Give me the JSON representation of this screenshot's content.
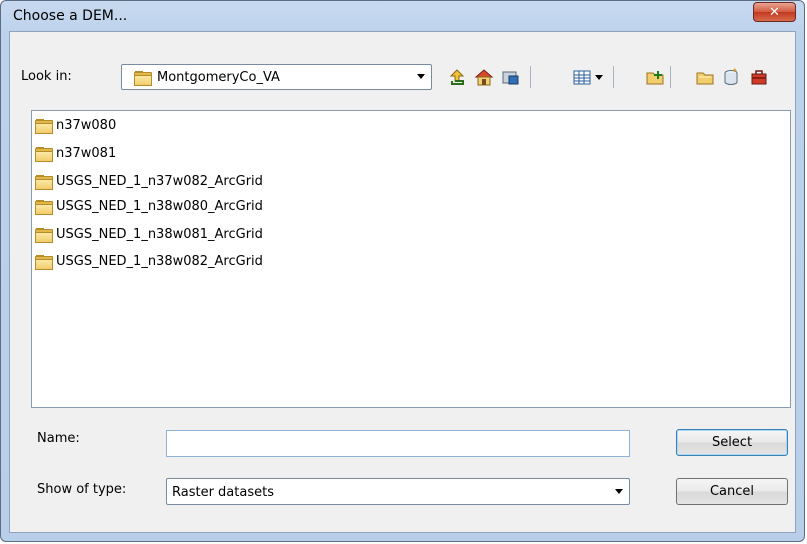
{
  "window": {
    "title": "Choose a DEM...",
    "close_glyph": "✕"
  },
  "lookin": {
    "label": "Look in:",
    "value": "MontgomeryCo_VA",
    "icons": [
      "up-one-level-icon",
      "home-icon",
      "network-folder-icon",
      "view-menu-icon",
      "connect-folder-icon",
      "new-folder-icon",
      "new-geodatabase-icon",
      "toolbox-icon"
    ]
  },
  "files": [
    {
      "name": "n37w080",
      "icon": "folder-icon"
    },
    {
      "name": "n37w081",
      "icon": "folder-icon"
    },
    {
      "name": "USGS_NED_1_n37w082_ArcGrid",
      "icon": "folder-icon"
    },
    {
      "name": "USGS_NED_1_n38w080_ArcGrid",
      "icon": "folder-icon"
    },
    {
      "name": "USGS_NED_1_n38w081_ArcGrid",
      "icon": "folder-icon"
    },
    {
      "name": "USGS_NED_1_n38w082_ArcGrid",
      "icon": "folder-icon"
    }
  ],
  "form": {
    "name_label": "Name:",
    "name_value": "",
    "type_label": "Show of type:",
    "type_value": "Raster datasets"
  },
  "buttons": {
    "select": "Select",
    "cancel": "Cancel"
  }
}
